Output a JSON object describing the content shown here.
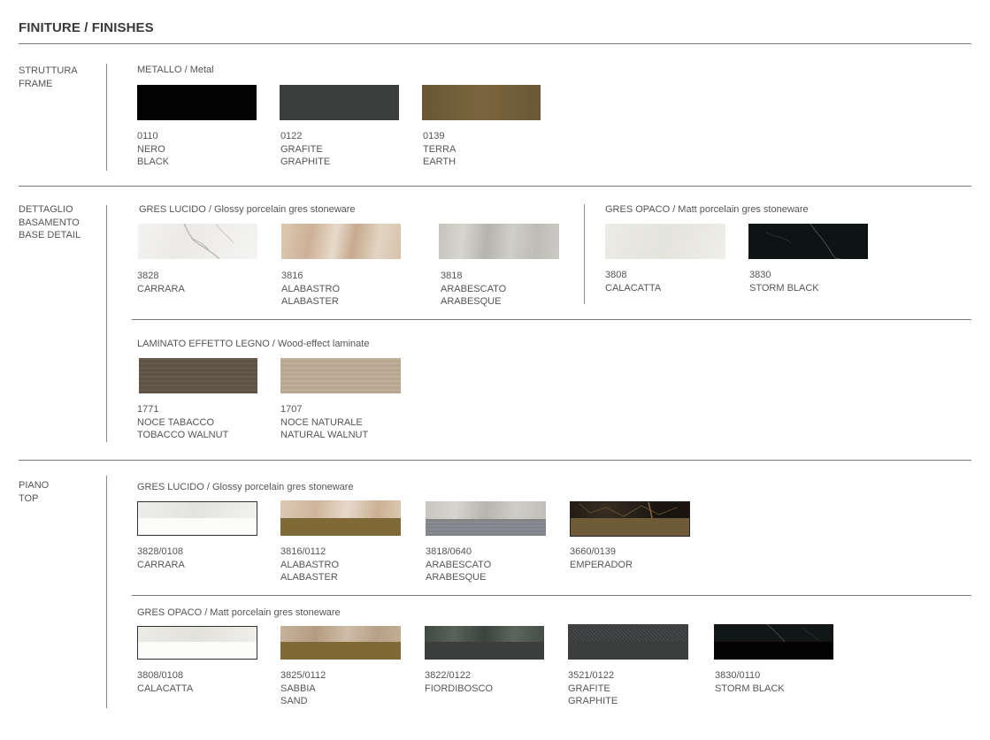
{
  "title": "FINITURE / FINISHES",
  "sections": {
    "frame": {
      "lines": [
        "STRUTTURA",
        "FRAME"
      ]
    },
    "base": {
      "lines": [
        "DETTAGLIO",
        "BASAMENTO",
        "BASE DETAIL"
      ]
    },
    "top": {
      "lines": [
        "PIANO",
        "TOP"
      ]
    }
  },
  "groups": {
    "metal": "METALLO / Metal",
    "base_glossy": "GRES LUCIDO / Glossy porcelain gres stoneware",
    "base_matt": "GRES OPACO / Matt porcelain gres stoneware",
    "base_wood": "LAMINATO EFFETTO LEGNO / Wood-effect laminate",
    "top_glossy": "GRES LUCIDO / Glossy porcelain gres stoneware",
    "top_matt": "GRES OPACO / Matt porcelain gres stoneware"
  },
  "swatches": {
    "s0110": [
      "0110",
      "NERO",
      "BLACK"
    ],
    "s0122": [
      "0122",
      "GRAFITE",
      "GRAPHITE"
    ],
    "s0139": [
      "0139",
      "TERRA",
      "EARTH"
    ],
    "b3828": [
      "3828",
      "CARRARA"
    ],
    "b3816": [
      "3816",
      "ALABASTRO",
      "ALABASTER"
    ],
    "b3818": [
      "3818",
      "ARABESCATO",
      "ARABESQUE"
    ],
    "b3808": [
      "3808",
      "CALACATTA"
    ],
    "b3830": [
      "3830",
      "STORM BLACK"
    ],
    "w1771": [
      "1771",
      "NOCE TABACCO",
      "TOBACCO WALNUT"
    ],
    "w1707": [
      "1707",
      "NOCE NATURALE",
      "NATURAL WALNUT"
    ],
    "t3828": [
      "3828/0108",
      "CARRARA"
    ],
    "t3816": [
      "3816/0112",
      "ALABASTRO",
      "ALABASTER"
    ],
    "t3818": [
      "3818/0640",
      "ARABESCATO",
      "ARABESQUE"
    ],
    "t3660": [
      "3660/0139",
      "EMPERADOR"
    ],
    "m3808": [
      "3808/0108",
      "CALACATTA"
    ],
    "m3825": [
      "3825/0112",
      "SABBIA",
      "SAND"
    ],
    "m3822": [
      "3822/0122",
      "FIORDIBOSCO"
    ],
    "m3521": [
      "3521/0122",
      "GRAFITE",
      "GRAPHITE"
    ],
    "m3830": [
      "3830/0110",
      "STORM BLACK"
    ]
  },
  "colors": {
    "nero": "#030303",
    "grafite": "#3c3e3d",
    "terra": "#6f5b38",
    "bronze": "#7f6a37",
    "line": "#7a7a7a"
  }
}
